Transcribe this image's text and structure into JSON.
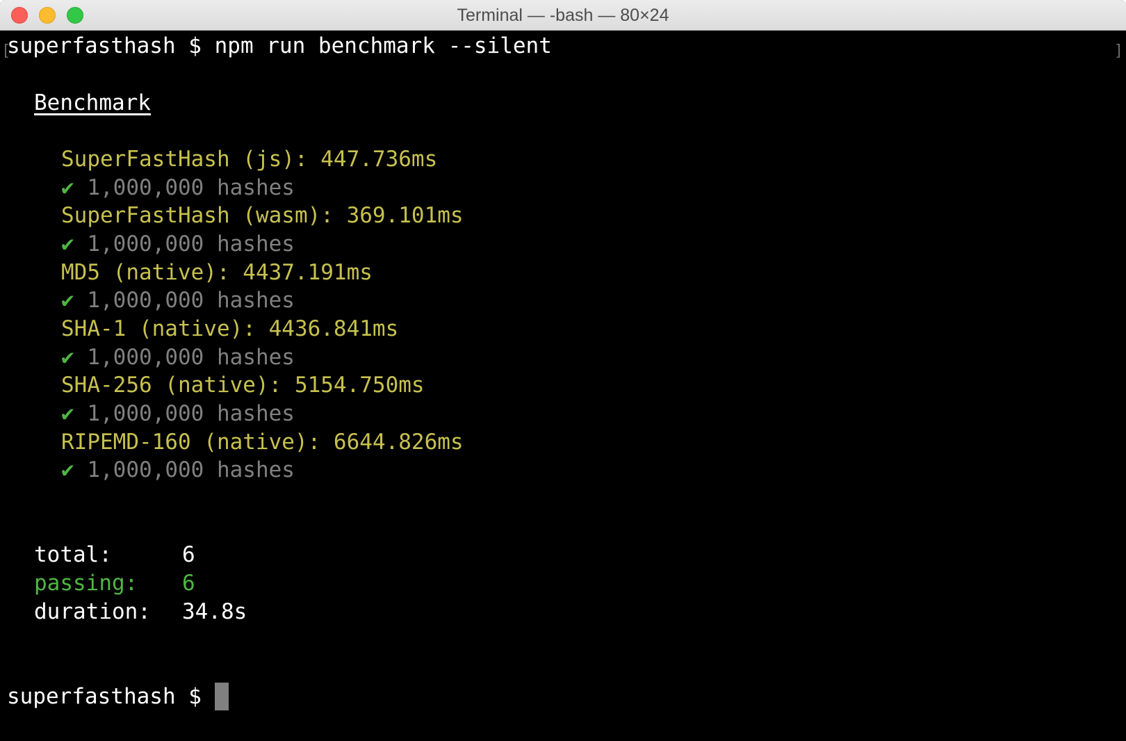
{
  "window": {
    "title": "Terminal — -bash — 80×24"
  },
  "terminal": {
    "prompt": "superfasthash $ ",
    "command": "npm run benchmark --silent",
    "heading": "Benchmark",
    "results": [
      {
        "label": "SuperFastHash (js): 447.736ms",
        "check": "✔",
        "detail": "1,000,000 hashes"
      },
      {
        "label": "SuperFastHash (wasm): 369.101ms",
        "check": "✔",
        "detail": "1,000,000 hashes"
      },
      {
        "label": "MD5 (native): 4437.191ms",
        "check": "✔",
        "detail": "1,000,000 hashes"
      },
      {
        "label": "SHA-1 (native): 4436.841ms",
        "check": "✔",
        "detail": "1,000,000 hashes"
      },
      {
        "label": "SHA-256 (native): 5154.750ms",
        "check": "✔",
        "detail": "1,000,000 hashes"
      },
      {
        "label": "RIPEMD-160 (native): 6644.826ms",
        "check": "✔",
        "detail": "1,000,000 hashes"
      }
    ],
    "summary": {
      "total_label": "total:",
      "total_value": "6",
      "passing_label": "passing:",
      "passing_value": "6",
      "duration_label": "duration:",
      "duration_value": "34.8s"
    },
    "final_prompt": "superfasthash $ "
  },
  "colors": {
    "background": "#000000",
    "text": "#ffffff",
    "result_label": "#c7c14f",
    "detail": "#808080",
    "success": "#4fb743"
  }
}
